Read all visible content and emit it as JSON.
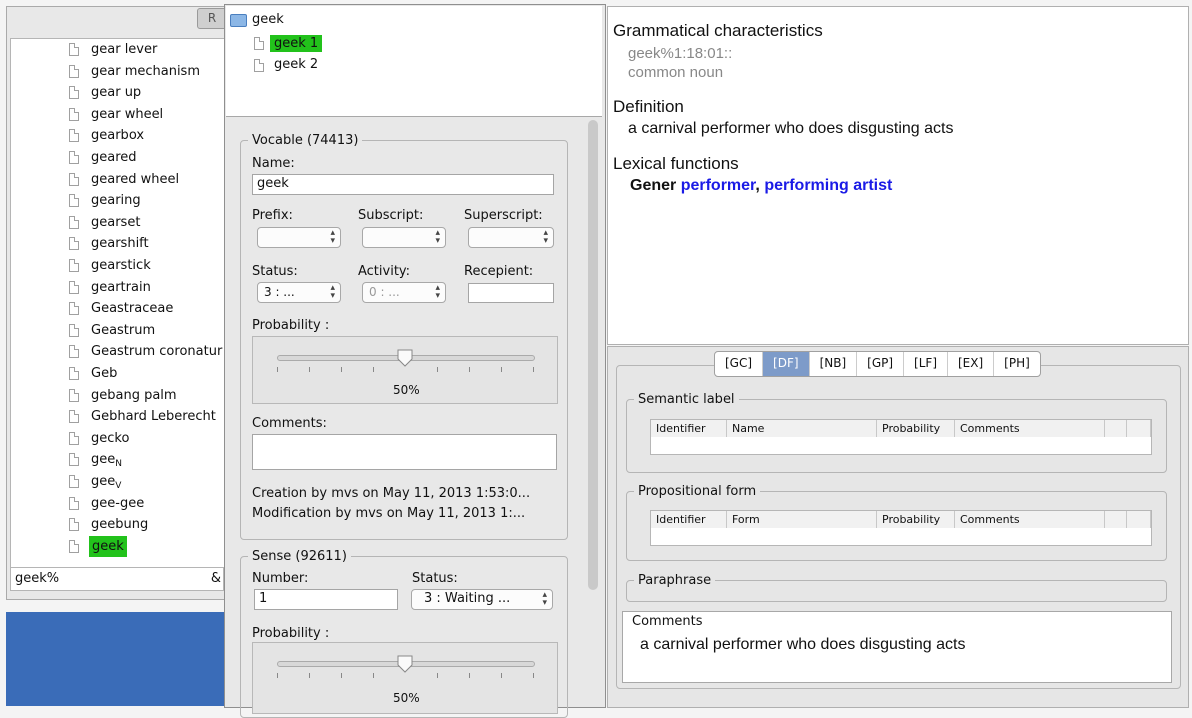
{
  "left_window": {
    "tab_label": "R",
    "word_list": [
      {
        "text": "gear lever",
        "sub": ""
      },
      {
        "text": "gear mechanism",
        "sub": ""
      },
      {
        "text": "gear up",
        "sub": ""
      },
      {
        "text": "gear wheel",
        "sub": ""
      },
      {
        "text": "gearbox",
        "sub": ""
      },
      {
        "text": "geared",
        "sub": ""
      },
      {
        "text": "geared wheel",
        "sub": ""
      },
      {
        "text": "gearing",
        "sub": ""
      },
      {
        "text": "gearset",
        "sub": ""
      },
      {
        "text": "gearshift",
        "sub": ""
      },
      {
        "text": "gearstick",
        "sub": ""
      },
      {
        "text": "geartrain",
        "sub": ""
      },
      {
        "text": "Geastraceae",
        "sub": ""
      },
      {
        "text": "Geastrum",
        "sub": ""
      },
      {
        "text": "Geastrum coronatur",
        "sub": ""
      },
      {
        "text": "Geb",
        "sub": ""
      },
      {
        "text": "gebang palm",
        "sub": ""
      },
      {
        "text": "Gebhard Leberecht",
        "sub": ""
      },
      {
        "text": "gecko",
        "sub": ""
      },
      {
        "text": "gee",
        "sub": "N"
      },
      {
        "text": "gee",
        "sub": "V"
      },
      {
        "text": "gee-gee",
        "sub": ""
      },
      {
        "text": "geebung",
        "sub": ""
      },
      {
        "text": "geek",
        "sub": "",
        "selected": true
      }
    ],
    "search_value": "geek%",
    "search_trailing": "&"
  },
  "tree": {
    "root": "geek",
    "children": [
      {
        "label": "geek 1",
        "selected": true
      },
      {
        "label": "geek 2",
        "selected": false
      }
    ]
  },
  "vocable": {
    "legend": "Vocable (74413)",
    "name_label": "Name:",
    "name_value": "geek",
    "prefix_label": "Prefix:",
    "subscript_label": "Subscript:",
    "superscript_label": "Superscript:",
    "status_label": "Status:",
    "status_value": "3 : ...",
    "activity_label": "Activity:",
    "activity_value": "0 : ...",
    "recipient_label": "Recepient:",
    "probability_label": "Probability :",
    "probability_text": "50%",
    "probability_level": 0.5,
    "comments_label": "Comments:",
    "creation": "Creation by mvs on May 11, 2013 1:53:0...",
    "modification": "Modification by mvs on May 11, 2013 1:..."
  },
  "sense": {
    "legend": "Sense (92611)",
    "number_label": "Number:",
    "number_value": "1",
    "status_label": "Status:",
    "status_value": "3 : Waiting ...",
    "probability_label": "Probability :",
    "probability_text": "50%",
    "probability_level": 0.5
  },
  "details": {
    "gram_heading": "Grammatical characteristics",
    "sense_key": "geek%1:18:01::",
    "pos": "common noun",
    "def_heading": "Definition",
    "definition": "a carnival performer who does disgusting acts",
    "lf_heading": "Lexical functions",
    "lf_name": "Gener",
    "lf_value_1": "performer",
    "lf_sep": ",",
    "lf_value_2": "performing artist"
  },
  "tabs": [
    {
      "label": "[GC]",
      "active": false
    },
    {
      "label": "[DF]",
      "active": true
    },
    {
      "label": "[NB]",
      "active": false
    },
    {
      "label": "[GP]",
      "active": false
    },
    {
      "label": "[LF]",
      "active": false
    },
    {
      "label": "[EX]",
      "active": false
    },
    {
      "label": "[PH]",
      "active": false
    }
  ],
  "semantic_label": {
    "legend": "Semantic label",
    "columns": [
      "Identifier",
      "Name",
      "Probability",
      "Comments"
    ]
  },
  "propositional_form": {
    "legend": "Propositional form",
    "columns": [
      "Identifier",
      "Form",
      "Probability",
      "Comments"
    ]
  },
  "paraphrase": {
    "legend": "Paraphrase"
  },
  "comments": {
    "legend": "Comments",
    "text": "a carnival performer who does disgusting acts"
  },
  "colors": {
    "selection": "#22c21b",
    "link_blue": "#1a1ae6",
    "desktop_blue": "#3a6cb8"
  }
}
